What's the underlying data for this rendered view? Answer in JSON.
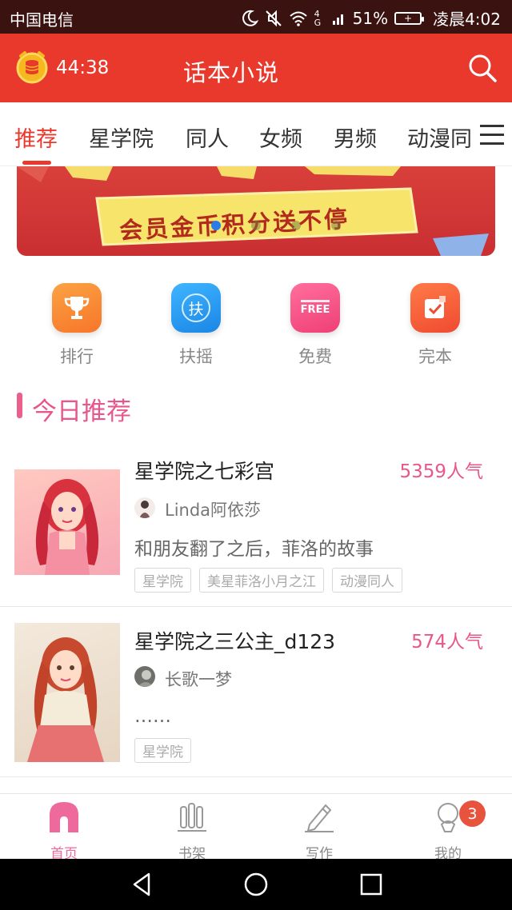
{
  "status_bar": {
    "carrier": "中国电信",
    "network": "4G",
    "battery_percent": "51%",
    "time": "凌晨4:02",
    "icons": [
      "moon-icon",
      "mute-icon",
      "wifi-icon",
      "signal-icon",
      "battery-icon"
    ]
  },
  "header": {
    "timer": "44:38",
    "title": "话本小说",
    "icons": [
      "timer-coin-icon",
      "search-icon"
    ]
  },
  "tabs": [
    {
      "label": "推荐",
      "active": true
    },
    {
      "label": "星学院",
      "active": false
    },
    {
      "label": "同人",
      "active": false
    },
    {
      "label": "女频",
      "active": false
    },
    {
      "label": "男频",
      "active": false
    },
    {
      "label": "动漫同",
      "active": false
    }
  ],
  "banner": {
    "text": "会员金币积分送不停",
    "pages": 4,
    "current_page": 1
  },
  "quick_entries": [
    {
      "label": "排行",
      "icon": "trophy-icon",
      "color": "#f7892e"
    },
    {
      "label": "扶摇",
      "icon": "fuyao-icon",
      "glyph": "扶",
      "color": "#2a9ef0"
    },
    {
      "label": "免费",
      "icon": "free-icon",
      "glyph": "FREE",
      "color": "#f0548a"
    },
    {
      "label": "完本",
      "icon": "complete-icon",
      "color": "#f25f3a"
    }
  ],
  "section": {
    "title": "今日推荐"
  },
  "books": [
    {
      "title": "星学院之七彩宫",
      "popularity": "5359人气",
      "author": "Linda阿依莎",
      "description": "和朋友翻了之后，菲洛的故事",
      "tags": [
        "星学院",
        "美星菲洛小月之江",
        "动漫同人"
      ]
    },
    {
      "title": "星学院之三公主_d123",
      "popularity": "574人气",
      "author": "长歌一梦",
      "description": "……",
      "tags": [
        "星学院"
      ]
    }
  ],
  "bottom_nav": [
    {
      "label": "首页",
      "icon": "home-icon",
      "active": true
    },
    {
      "label": "书架",
      "icon": "bookshelf-icon",
      "active": false
    },
    {
      "label": "写作",
      "icon": "pen-icon",
      "active": false
    },
    {
      "label": "我的",
      "icon": "profile-icon",
      "active": false
    }
  ],
  "profile_badge": "3",
  "colors": {
    "brand_red": "#e8392c",
    "accent_pink": "#e8578b",
    "status_bar": "#3a1210"
  }
}
